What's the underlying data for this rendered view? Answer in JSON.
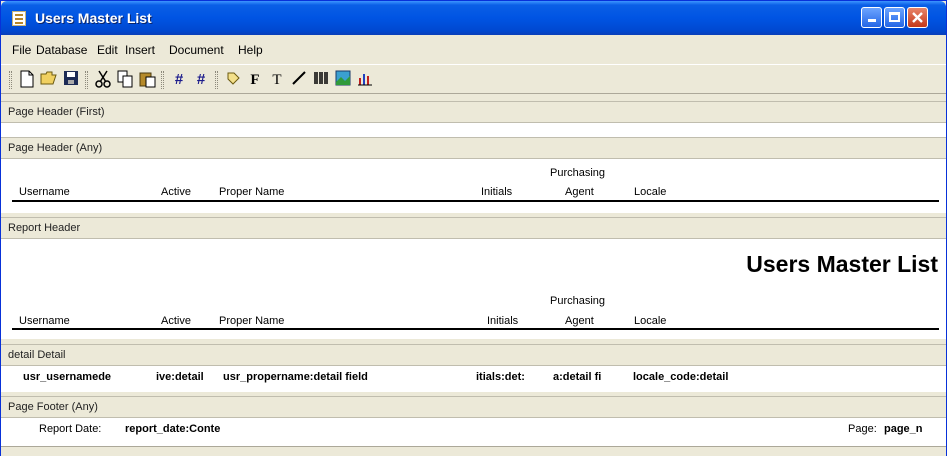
{
  "window": {
    "title": "Users Master List"
  },
  "menu": [
    "File",
    "Database",
    "Edit",
    "Insert",
    "Document",
    "Help"
  ],
  "toolbar": {
    "icons": [
      "new-document-icon",
      "open-folder-icon",
      "save-icon",
      "cut-icon",
      "copy-icon",
      "paste-icon",
      "grid-icon",
      "snap-grid-icon",
      "pointer-tag-icon",
      "field-tool-icon",
      "text-tool-icon",
      "line-tool-icon",
      "barcode-icon",
      "image-icon",
      "chart-icon"
    ],
    "field_glyph": "F",
    "text_glyph": "T",
    "grid_glyph": "#"
  },
  "sections": {
    "page_header_first": "Page Header (First)",
    "page_header_any": "Page Header (Any)",
    "report_header": "Report Header",
    "detail": "detail Detail",
    "page_footer": "Page Footer (Any)"
  },
  "columns": {
    "username": "Username",
    "active": "Active",
    "proper_name": "Proper Name",
    "initials": "Initials",
    "purchasing": "Purchasing",
    "agent": "Agent",
    "locale": "Locale"
  },
  "report_header": {
    "title": "Users Master List"
  },
  "detail_fields": {
    "username": "usr_usernamede",
    "active": "ive:detail",
    "proper_name": "usr_propername:detail field",
    "initials": "itials:det:",
    "agent": "a:detail fi",
    "locale": "locale_code:detail"
  },
  "footer": {
    "date_label": "Report Date:",
    "date_field": "report_date:Conte",
    "page_label": "Page:",
    "page_field": "page_n"
  }
}
